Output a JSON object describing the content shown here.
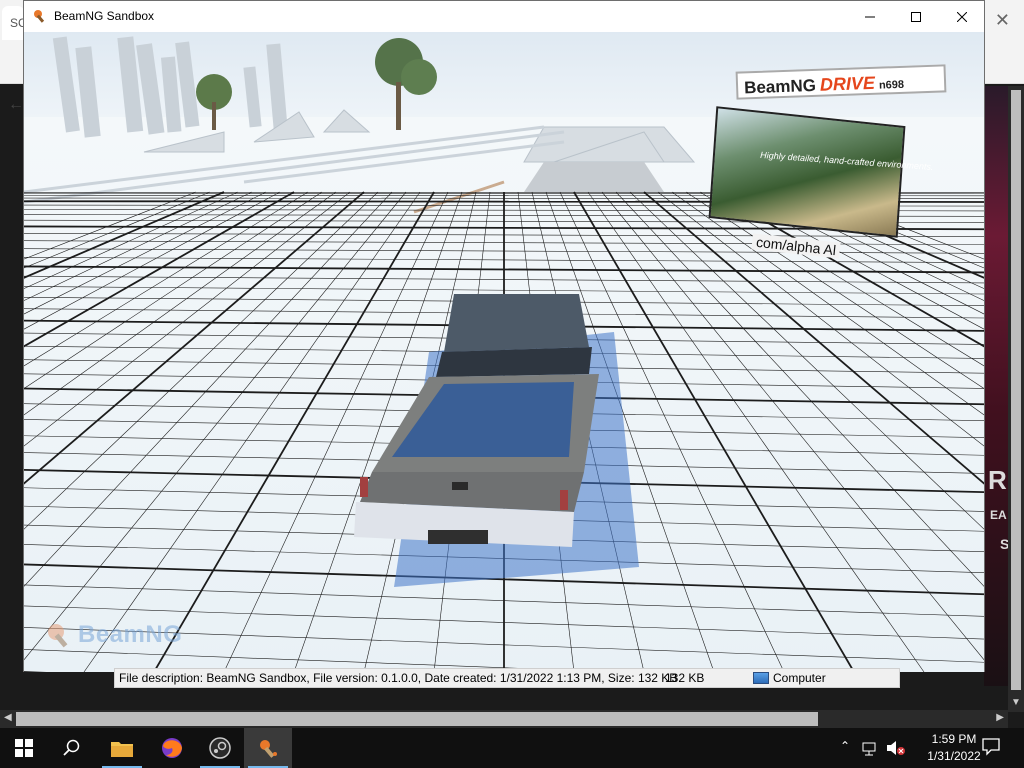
{
  "window": {
    "title": "BeamNG Sandbox"
  },
  "background_app": {
    "tab_label": "SC",
    "right_text_1": "R",
    "right_text_2": "EA",
    "right_text_3": "S"
  },
  "game": {
    "watermark": "BeamNG",
    "billboard": {
      "brand": "BeamNG",
      "product": "DRIVE",
      "build": "n698",
      "caption": "Highly detailed, hand-crafted environments.",
      "url": "com/alpha  Al"
    }
  },
  "status_strip": {
    "description": "File description: BeamNG Sandbox, File version: 0.1.0.0, Date created: 1/31/2022 1:13 PM, Size: 132 KB",
    "size": "132 KB",
    "zone": "Computer"
  },
  "taskbar": {
    "time": "1:59 PM",
    "date": "1/31/2022",
    "apps": [
      "start-icon",
      "search-icon",
      "file-explorer-icon",
      "firefox-icon",
      "steam-icon",
      "beamng-icon"
    ]
  },
  "colors": {
    "accent": "#e5461c",
    "taskbar": "#101010",
    "highlight": "#76b9ed"
  }
}
